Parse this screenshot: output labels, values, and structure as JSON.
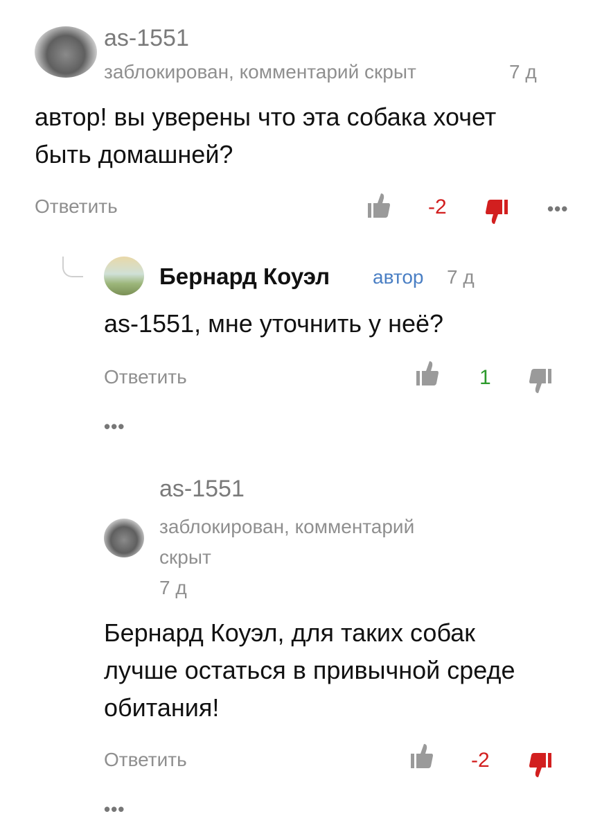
{
  "comments": [
    {
      "username": "as-1551",
      "meta": "заблокирован, комментарий скрыт",
      "time": "7 д",
      "text_lines": [
        "автор! вы уверены что эта собака хочет",
        "быть домашней?"
      ],
      "reply_label": "Ответить",
      "score": "-2",
      "more": "•••"
    },
    {
      "username": "Бернард Коуэл",
      "badge": "автор",
      "time": "7 д",
      "text_lines": [
        "as-1551, мне уточнить у неё?"
      ],
      "reply_label": "Ответить",
      "score": "1",
      "more": "•••"
    },
    {
      "username": "as-1551",
      "meta_lines": [
        "заблокирован, комментарий",
        "скрыт"
      ],
      "time": "7 д",
      "text_lines": [
        "Бернард Коуэл, для таких собак",
        "лучше остаться в привычной среде",
        "обитания!"
      ],
      "reply_label": "Ответить",
      "score": "-2",
      "more": "•••"
    }
  ],
  "colors": {
    "negative": "#d21f1f",
    "positive": "#2c9a2c",
    "author_badge": "#4a7fc4",
    "dislike_icon": "#d21f1f"
  },
  "icons": {
    "like": "thumbs-up-icon",
    "dislike": "thumbs-down-icon",
    "more": "more-dots-icon"
  }
}
